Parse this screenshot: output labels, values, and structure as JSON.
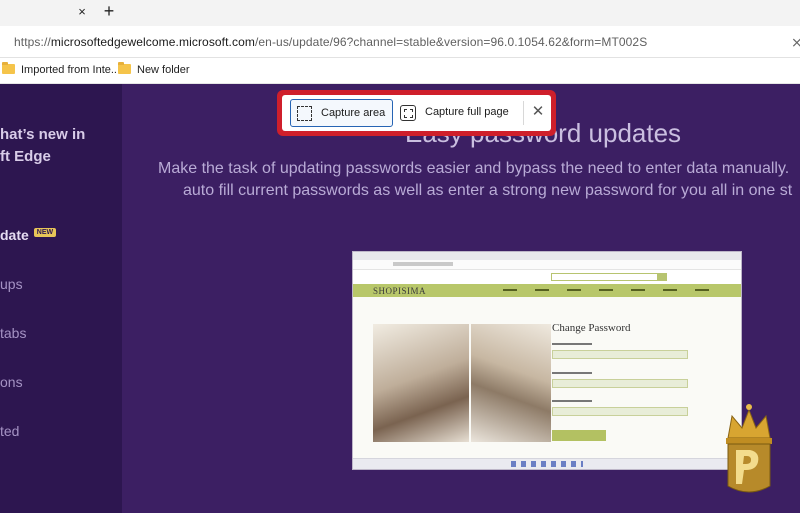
{
  "browser": {
    "url_prefix": "https://",
    "url_host": "microsoftedgewelcome.microsoft.com",
    "url_path": "/en-us/update/96?channel=stable&version=96.0.1054.62&form=MT002S",
    "tab_close": "×",
    "new_tab": "+",
    "address_close": "⨯"
  },
  "favorites": [
    {
      "label": "Imported from Inte...",
      "icon": "folder-icon"
    },
    {
      "label": "New folder",
      "icon": "folder-icon"
    }
  ],
  "sidebar": {
    "title_line1": "hat’s new in",
    "title_line2": "ft Edge",
    "items": [
      {
        "label": "date",
        "badge": "NEW",
        "active": true
      },
      {
        "label": "ups"
      },
      {
        "label": "tabs"
      },
      {
        "label": "ons"
      },
      {
        "label": "ted"
      }
    ]
  },
  "main": {
    "heading": "Easy password updates",
    "desc_line1": "Make the task of updating passwords easier and bypass the need to enter data manually.",
    "desc_line2": "auto fill current passwords as well as enter a strong new password for you all in one st"
  },
  "preview": {
    "brand": "SHOPISIMA",
    "title": "Change Password"
  },
  "capture_toolbar": {
    "area_label": "Capture area",
    "full_label": "Capture full page",
    "close": "✕"
  },
  "colors": {
    "capture_border": "#cf1f2b",
    "page_bg": "#3c1f63",
    "sidebar_bg": "#2d1650",
    "accent_green": "#b8c76a"
  }
}
